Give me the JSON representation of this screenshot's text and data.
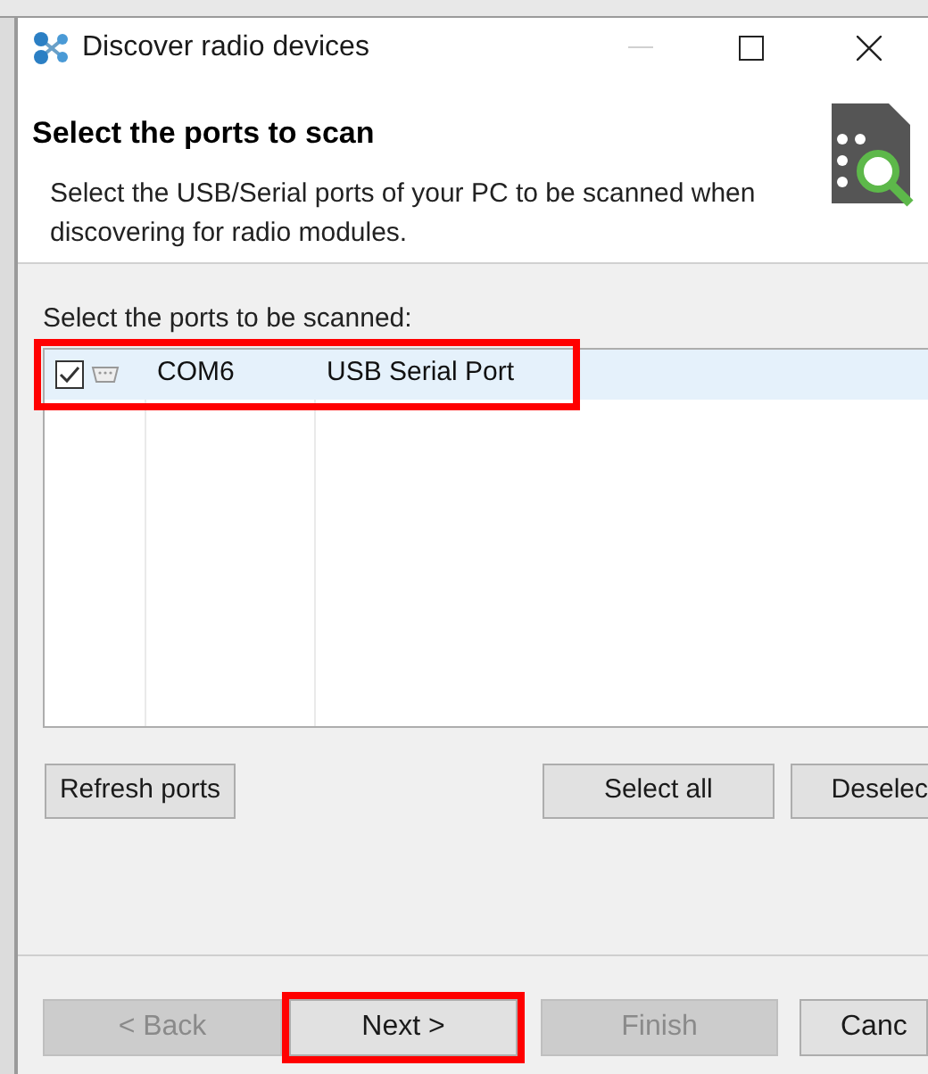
{
  "window": {
    "title": "Discover radio devices"
  },
  "header": {
    "title": "Select the ports to scan",
    "description": "Select the USB/Serial ports of your PC to be scanned when discovering for radio modules."
  },
  "ports": {
    "label": "Select the ports to be scanned:",
    "rows": [
      {
        "checked": true,
        "selected": true,
        "highlighted": true,
        "port": "COM6",
        "description": "USB Serial Port"
      }
    ]
  },
  "list_buttons": [
    {
      "label": "Refresh ports"
    },
    {
      "label": "Select all"
    },
    {
      "label": "Deselec"
    }
  ],
  "nav_buttons": [
    {
      "label": "< Back",
      "disabled": true,
      "highlighted": false
    },
    {
      "label": "Next >",
      "disabled": false,
      "highlighted": true
    },
    {
      "label": "Finish",
      "disabled": true,
      "highlighted": false
    },
    {
      "label": "Canc",
      "disabled": false,
      "highlighted": false
    }
  ]
}
